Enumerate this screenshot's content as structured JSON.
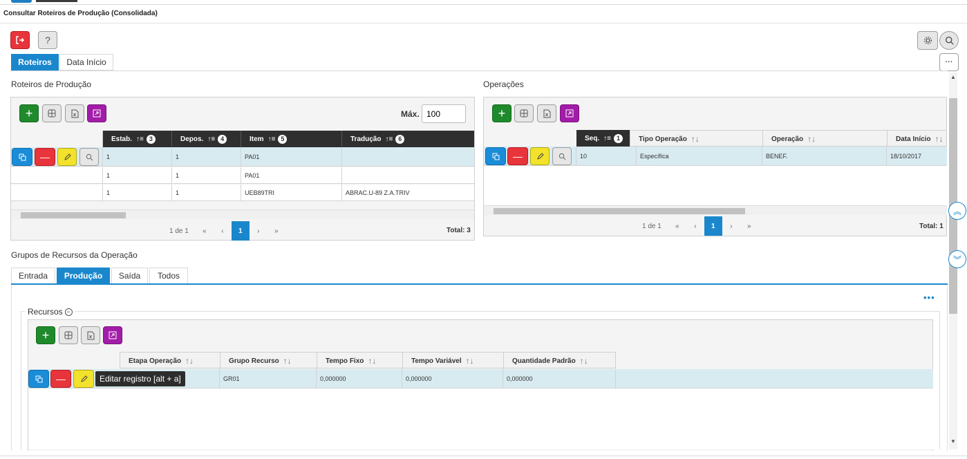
{
  "page": {
    "title": "Consultar Roteiros de Produção (Consolidada)"
  },
  "toolbar": {
    "exit_icon": "exit-icon",
    "help_label": "?",
    "settings_icon": "gear-icon",
    "search_icon": "search-icon",
    "more_label": "···"
  },
  "main_tabs": [
    {
      "label": "Roteiros",
      "active": true
    },
    {
      "label": "Data Início",
      "active": false
    }
  ],
  "roteiros": {
    "title": "Roteiros de Produção",
    "max_label": "Máx.",
    "max_value": "100",
    "columns": [
      {
        "label": "Estab.",
        "badge": "3"
      },
      {
        "label": "Depos.",
        "badge": "4"
      },
      {
        "label": "Item",
        "badge": "5"
      },
      {
        "label": "Tradução",
        "badge": "6"
      }
    ],
    "rows": [
      [
        "1",
        "1",
        "PA01",
        ""
      ],
      [
        "1",
        "1",
        "PA01",
        ""
      ],
      [
        "1",
        "1",
        "UEB89TRI",
        "ABRAC.U-89 Z.A.TRIV"
      ]
    ],
    "pager": {
      "info": "1 de 1",
      "first": "«",
      "prev": "‹",
      "page": "1",
      "next": "›",
      "last": "»",
      "total": "Total: 3"
    }
  },
  "operacoes": {
    "title": "Operações",
    "columns": [
      {
        "label": "Seq.",
        "badge": "1"
      },
      {
        "label": "Tipo Operação"
      },
      {
        "label": "Operação"
      },
      {
        "label": "Data Início"
      }
    ],
    "rows": [
      [
        "10",
        "Específica",
        "BENEF.",
        "18/10/2017"
      ]
    ],
    "pager": {
      "info": "1 de 1",
      "first": "«",
      "prev": "‹",
      "page": "1",
      "next": "›",
      "last": "»",
      "total": "Total: 1"
    }
  },
  "grupos": {
    "title": "Grupos de Recursos da Operação",
    "tabs": [
      {
        "label": "Entrada",
        "active": false
      },
      {
        "label": "Produção",
        "active": true
      },
      {
        "label": "Saída",
        "active": false
      },
      {
        "label": "Todos",
        "active": false
      }
    ],
    "more_label": "•••",
    "recursos_label": "Recursos",
    "columns": [
      {
        "label": "Etapa Operação"
      },
      {
        "label": "Grupo Recurso"
      },
      {
        "label": "Tempo Fixo"
      },
      {
        "label": "Tempo Variável"
      },
      {
        "label": "Quantidade Padrão"
      }
    ],
    "rows": [
      [
        "",
        "GR01",
        "0,000000",
        "0,000000",
        "0,000000"
      ]
    ],
    "tooltip": "Editar registro [alt + a]"
  },
  "colors": {
    "accent": "#1a87cc",
    "red": "#e8343b",
    "green": "#1e8a2b",
    "purple": "#a21ca8",
    "yellow": "#f2e22b",
    "header_dark": "#2f2f2f",
    "selected_row": "#d8ebf1"
  }
}
